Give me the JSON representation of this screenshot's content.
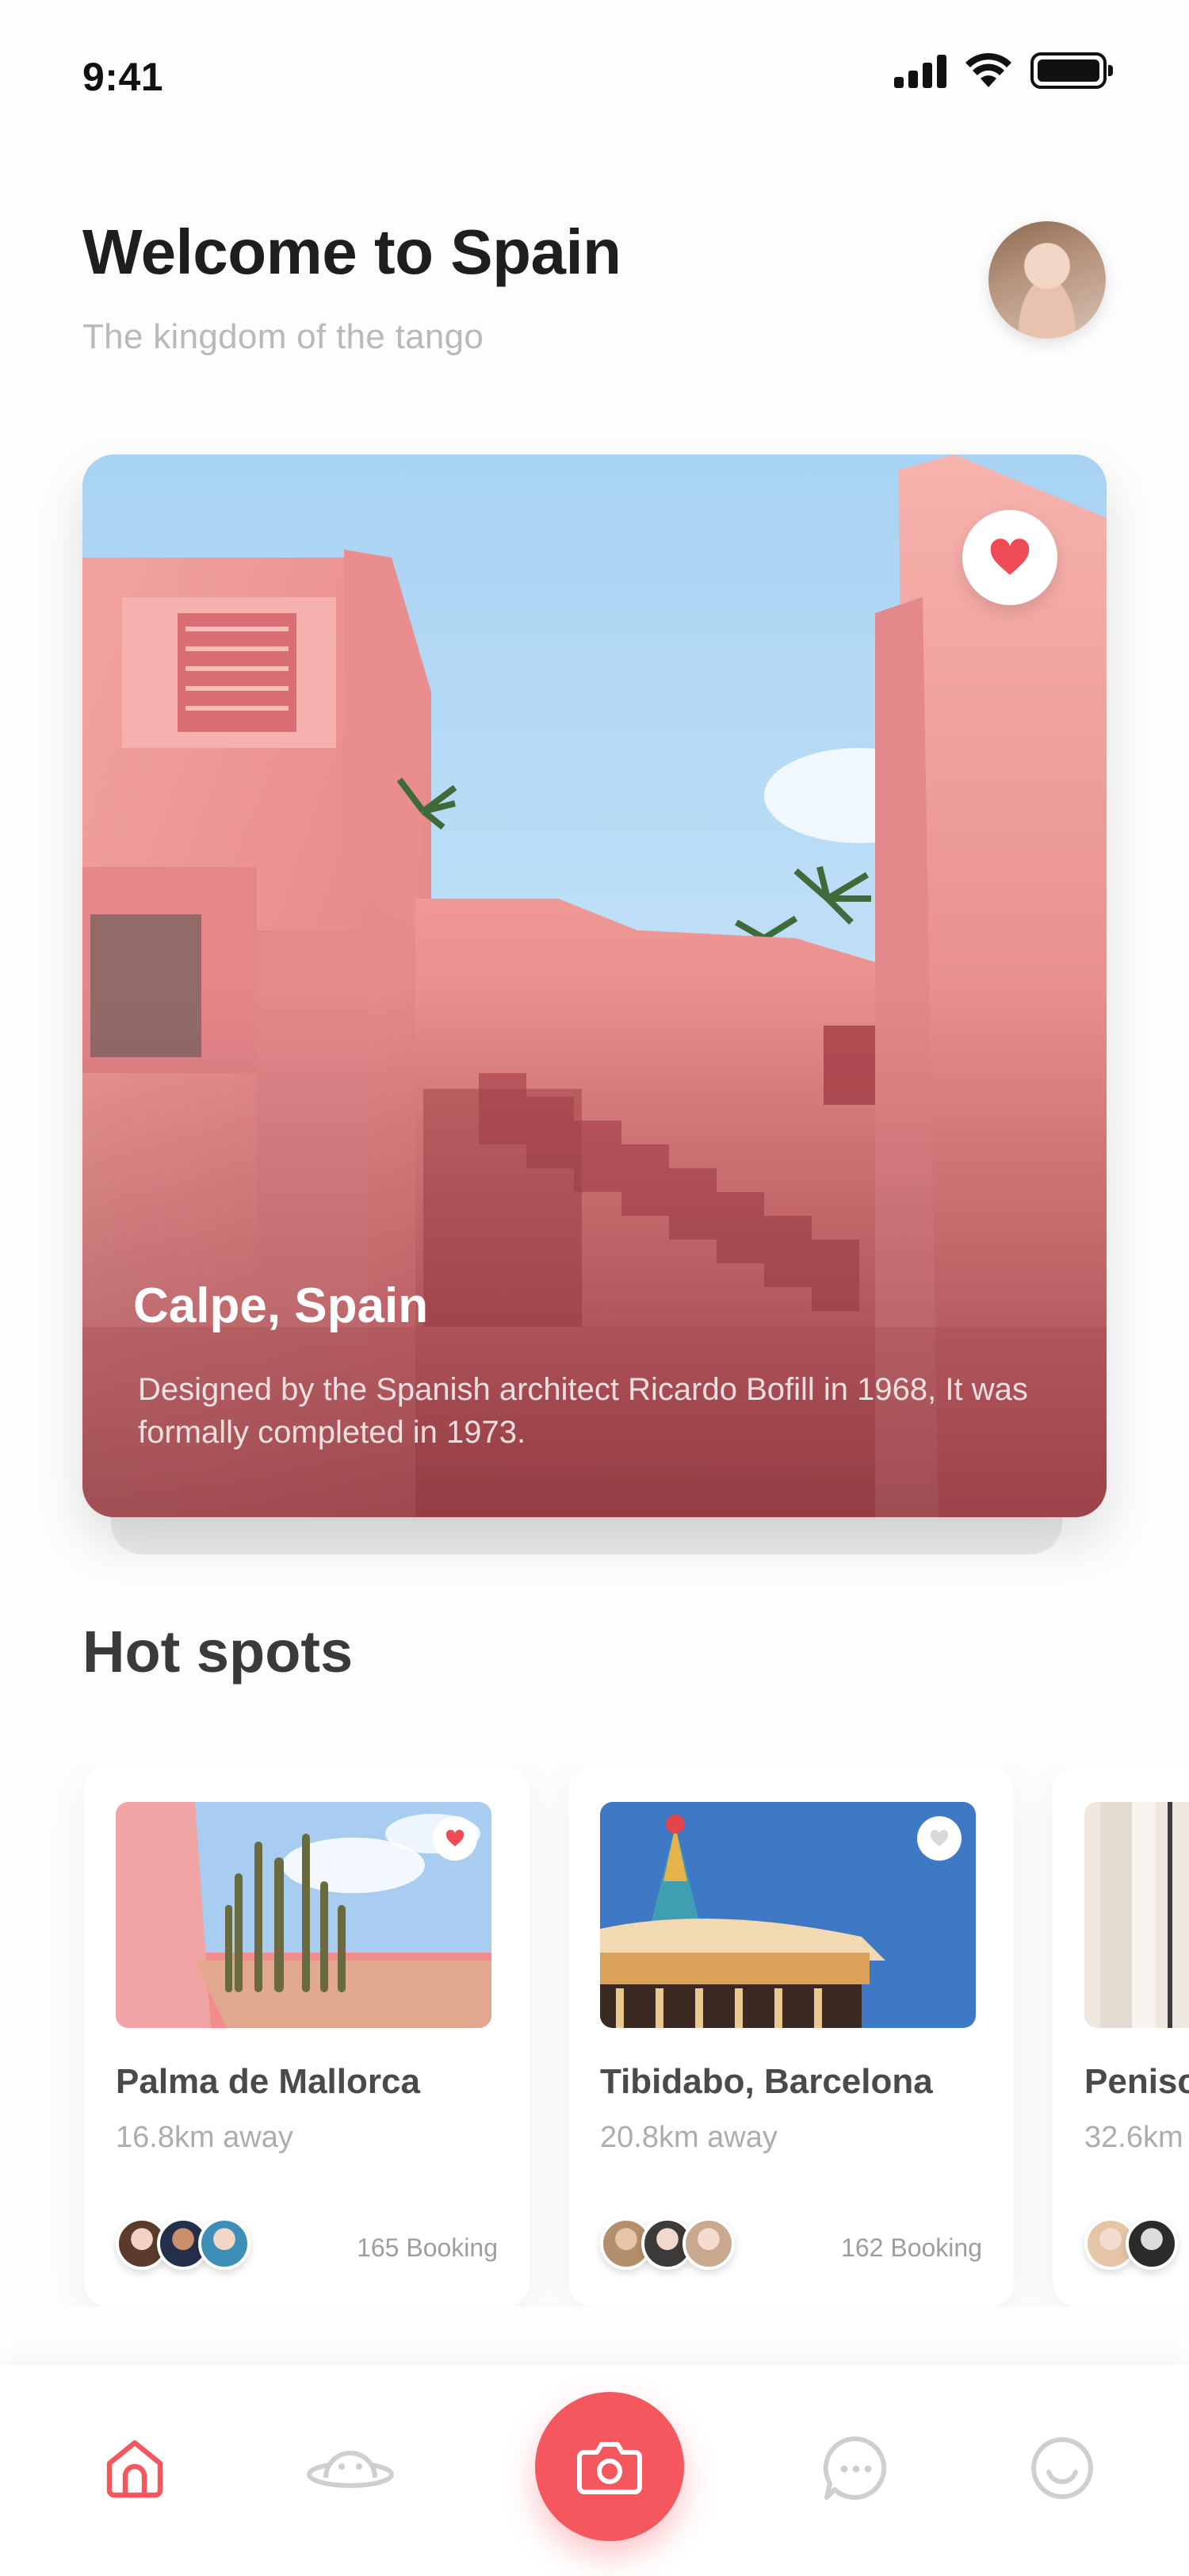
{
  "status_bar": {
    "time": "9:41"
  },
  "header": {
    "title": "Welcome to Spain",
    "subtitle": "The kingdom of the tango"
  },
  "featured": {
    "title": "Calpe, Spain",
    "description": "Designed by the Spanish architect Ricardo Bofill in 1968, It was formally completed in 1973.",
    "favorited": true
  },
  "hot_spots": {
    "title": "Hot spots",
    "items": [
      {
        "name": "Palma de Mallorca",
        "distance": "16.8km away",
        "booking": "165 Booking",
        "favorited": true
      },
      {
        "name": "Tibidabo, Barcelona",
        "distance": "20.8km away",
        "booking": "162 Booking",
        "favorited": false
      },
      {
        "name": "Penisc",
        "distance": "32.6km",
        "booking": "",
        "favorited": false
      }
    ]
  },
  "bottom_nav": {
    "items": [
      "home-icon",
      "planet-icon",
      "camera-icon",
      "chat-icon",
      "profile-icon"
    ],
    "active": "home-icon"
  },
  "colors": {
    "accent": "#f5575f",
    "title": "#1e1e1e",
    "muted": "#b9b9b9"
  }
}
